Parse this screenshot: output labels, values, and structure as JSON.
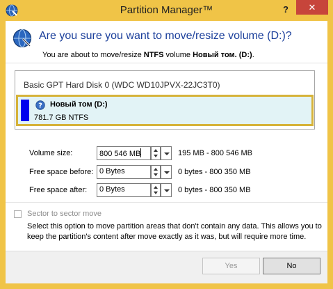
{
  "window": {
    "title": "Partition Manager™",
    "help_glyph": "?",
    "close_glyph": "✕"
  },
  "header": {
    "title": "Are you sure you want to move/resize volume (D:)?",
    "subtitle_prefix": "You are about to move/resize ",
    "subtitle_fs": "NTFS",
    "subtitle_mid": " volume ",
    "subtitle_volume": "Новый том. (D:)",
    "subtitle_end": "."
  },
  "disk": {
    "title": "Basic GPT Hard Disk 0 (WDC WD10JPVX-22JC3T0)",
    "partition": {
      "name": "Новый том (D:)",
      "size": "781.7 GB NTFS",
      "color": "#0000ee",
      "icon": "question-icon"
    }
  },
  "fields": {
    "volume_size": {
      "label": "Volume size:",
      "value_num": "800 546",
      "unit": "MB",
      "range": "195 MB - 800 546 MB"
    },
    "free_before": {
      "label": "Free space before:",
      "value": "0 Bytes",
      "range": "0 bytes - 800 350 MB"
    },
    "free_after": {
      "label": "Free space after:",
      "value": "0 Bytes",
      "range": "0 bytes - 800 350 MB"
    }
  },
  "sector": {
    "label": "Sector to sector move",
    "checked": false,
    "description": "Select this option to move partition areas that don't contain any data. This allows you to keep the partition's content after move exactly as it was, but will require more time."
  },
  "buttons": {
    "yes": "Yes",
    "no": "No"
  },
  "colors": {
    "accent_border": "#f0c447",
    "title_blue": "#1b3f9b",
    "partition_highlight": "#d6b33a"
  }
}
